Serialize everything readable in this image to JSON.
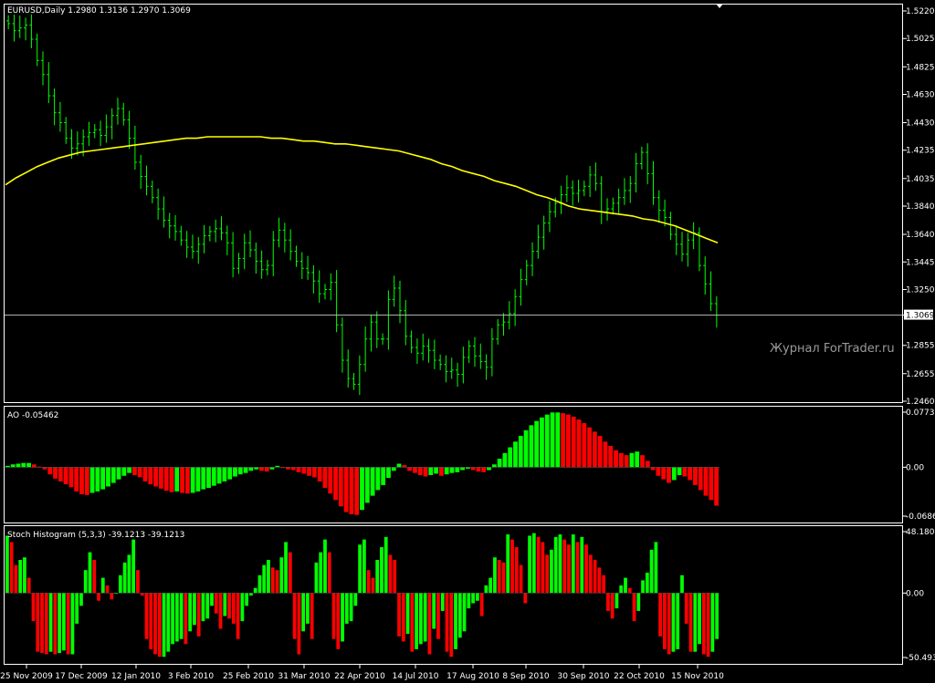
{
  "window": {
    "symbol_header": "EURUSD,Daily  1.2980 1.3136 1.2970 1.3069",
    "watermark": "Журнал ForTrader.ru"
  },
  "colors": {
    "background": "#000000",
    "frame": "#ffffff",
    "bull": "#00ff00",
    "bear": "#ff0000",
    "ma": "#ffff00",
    "watermark": "#9a9a9a"
  },
  "chart_data": [
    {
      "type": "line",
      "title": "EURUSD,Daily  1.2980 1.3136 1.2970 1.3069",
      "series": [
        {
          "name": "",
          "color": "#00ff00",
          "values": [
            1.513,
            1.508,
            1.51,
            1.512,
            1.502,
            1.487,
            1.477,
            1.462,
            1.45,
            1.443,
            1.432,
            1.425,
            1.428,
            1.433,
            1.436,
            1.438,
            1.434,
            1.44,
            1.448,
            1.453,
            1.445,
            1.432,
            1.415,
            1.405,
            1.398,
            1.39,
            1.382,
            1.374,
            1.37,
            1.366,
            1.36,
            1.355,
            1.352,
            1.357,
            1.363,
            1.366,
            1.368,
            1.365,
            1.358,
            1.34,
            1.347,
            1.358,
            1.353,
            1.345,
            1.339,
            1.342,
            1.36,
            1.367,
            1.36,
            1.352,
            1.345,
            1.34,
            1.337,
            1.331,
            1.322,
            1.325,
            1.33,
            1.3,
            1.275,
            1.262,
            1.258,
            1.272,
            1.29,
            1.302,
            1.29,
            1.29,
            1.318,
            1.326,
            1.31,
            1.292,
            1.284,
            1.28,
            1.285,
            1.282,
            1.275,
            1.272,
            1.267,
            1.268,
            1.265,
            1.277,
            1.285,
            1.278,
            1.274,
            1.27,
            1.29,
            1.3,
            1.302,
            1.308,
            1.32,
            1.332,
            1.342,
            1.352,
            1.362,
            1.372,
            1.38,
            1.386,
            1.392,
            1.397,
            1.393,
            1.395,
            1.398,
            1.406,
            1.4,
            1.38,
            1.382,
            1.386,
            1.39,
            1.395,
            1.4,
            1.414,
            1.422,
            1.407,
            1.39,
            1.381,
            1.376,
            1.364,
            1.357,
            1.35,
            1.36,
            1.365,
            1.342,
            1.329,
            1.315,
            1.3069
          ]
        },
        {
          "name": "",
          "color": "#ffff00",
          "values": [
            1.399,
            1.404,
            1.408,
            1.412,
            1.415,
            1.418,
            1.42,
            1.422,
            1.423,
            1.424,
            1.425,
            1.426,
            1.427,
            1.428,
            1.429,
            1.43,
            1.431,
            1.432,
            1.432,
            1.433,
            1.433,
            1.433,
            1.433,
            1.433,
            1.433,
            1.432,
            1.432,
            1.431,
            1.43,
            1.43,
            1.429,
            1.428,
            1.428,
            1.427,
            1.426,
            1.425,
            1.424,
            1.423,
            1.421,
            1.419,
            1.417,
            1.414,
            1.412,
            1.409,
            1.407,
            1.405,
            1.402,
            1.4,
            1.398,
            1.395,
            1.392,
            1.39,
            1.387,
            1.384,
            1.382,
            1.381,
            1.38,
            1.379,
            1.378,
            1.377,
            1.375,
            1.374,
            1.372,
            1.37,
            1.367,
            1.364,
            1.361,
            1.358
          ]
        }
      ],
      "ylim": [
        1.246,
        1.522
      ],
      "y_ticks": [
        "1.5220",
        "1.5025",
        "1.4825",
        "1.4630",
        "1.4430",
        "1.4235",
        "1.4035",
        "1.3840",
        "1.3640",
        "1.3445",
        "1.3250",
        "1.3069",
        "1.2855",
        "1.2655",
        "1.2460"
      ],
      "x_ticks": [
        "25 Nov 2009",
        "17 Dec 2009",
        "12 Jan 2010",
        "3 Feb 2010",
        "25 Feb 2010",
        "31 Mar 2010",
        "22 Apr 2010",
        "14 Jul 2010",
        "17 Aug 2010",
        "8 Sep 2010",
        "30 Sep 2010",
        "22 Oct 2010",
        "15 Nov 2010"
      ],
      "current_price": "1.3069",
      "grid": false
    },
    {
      "type": "bar",
      "title": "AO -0.05462",
      "ylim": [
        -0.06868,
        0.07738
      ],
      "y_ticks": [
        "0.07738",
        "0.00",
        "-0.06868"
      ],
      "values": [
        0.002,
        0.004,
        0.005,
        0.006,
        0.006,
        0.004,
        0.001,
        -0.003,
        -0.01,
        -0.016,
        -0.02,
        -0.024,
        -0.028,
        -0.034,
        -0.038,
        -0.039,
        -0.036,
        -0.034,
        -0.031,
        -0.027,
        -0.022,
        -0.017,
        -0.012,
        -0.008,
        -0.011,
        -0.014,
        -0.02,
        -0.024,
        -0.027,
        -0.03,
        -0.033,
        -0.035,
        -0.034,
        -0.036,
        -0.037,
        -0.036,
        -0.034,
        -0.031,
        -0.029,
        -0.026,
        -0.023,
        -0.02,
        -0.017,
        -0.013,
        -0.01,
        -0.008,
        -0.005,
        -0.003,
        -0.005,
        -0.006,
        -0.003,
        0.002,
        -0.001,
        -0.003,
        -0.004,
        -0.007,
        -0.009,
        -0.012,
        -0.014,
        -0.02,
        -0.029,
        -0.037,
        -0.046,
        -0.055,
        -0.063,
        -0.066,
        -0.067,
        -0.06,
        -0.05,
        -0.04,
        -0.032,
        -0.025,
        -0.015,
        -0.005,
        0.005,
        0.003,
        -0.005,
        -0.008,
        -0.011,
        -0.013,
        -0.011,
        -0.009,
        -0.012,
        -0.01,
        -0.008,
        -0.007,
        -0.004,
        -0.002,
        -0.004,
        -0.006,
        -0.007,
        -0.004,
        0.004,
        0.012,
        0.02,
        0.028,
        0.036,
        0.044,
        0.052,
        0.059,
        0.065,
        0.07,
        0.074,
        0.077,
        0.077,
        0.076,
        0.074,
        0.071,
        0.067,
        0.062,
        0.056,
        0.05,
        0.044,
        0.036,
        0.03,
        0.024,
        0.02,
        0.017,
        0.02,
        0.022,
        0.017,
        0.009,
        -0.004,
        -0.012,
        -0.017,
        -0.022,
        -0.018,
        -0.011,
        -0.013,
        -0.018,
        -0.025,
        -0.032,
        -0.04,
        -0.046,
        -0.054
      ]
    },
    {
      "type": "bar",
      "title": "Stoch Histogram (5,3,3) -39.1213 -39.1213",
      "ylim": [
        -50.4931,
        48.1807
      ],
      "y_ticks": [
        "48.1807",
        "0.00",
        "-50.4931"
      ],
      "values": [
        45,
        40,
        22,
        26,
        28,
        12,
        -22,
        -46,
        -47,
        -48,
        -46,
        -48,
        -47,
        -45,
        -48,
        -48,
        -24,
        -10,
        18,
        32,
        26,
        -6,
        12,
        6,
        -5,
        0,
        14,
        24,
        30,
        42,
        18,
        -2,
        -36,
        -44,
        -48,
        -50,
        -50,
        -46,
        -40,
        -38,
        -36,
        -40,
        -30,
        -25,
        -34,
        -22,
        -20,
        -10,
        -16,
        -28,
        -18,
        -20,
        -24,
        -36,
        -22,
        -10,
        -2,
        4,
        14,
        22,
        26,
        20,
        18,
        28,
        40,
        32,
        -36,
        -48,
        -30,
        -24,
        -36,
        24,
        32,
        42,
        32,
        -36,
        -44,
        -38,
        -24,
        -22,
        -10,
        38,
        42,
        18,
        12,
        26,
        36,
        44,
        30,
        26,
        -34,
        -38,
        -32,
        -46,
        -44,
        -40,
        -38,
        -48,
        -28,
        -36,
        -14,
        -46,
        -50,
        -44,
        -35,
        -30,
        -12,
        -8,
        -6,
        -18,
        6,
        12,
        28,
        26,
        24,
        46,
        42,
        36,
        22,
        -8,
        45,
        47,
        44,
        40,
        30,
        34,
        44,
        46,
        42,
        38,
        46,
        40,
        44,
        38,
        30,
        26,
        20,
        14,
        -14,
        -20,
        -12,
        6,
        12,
        4,
        -22,
        -14,
        10,
        16,
        34,
        40,
        -34,
        -44,
        -48,
        -46,
        -44,
        14,
        -24,
        -46,
        -46,
        -40,
        -48,
        -50,
        -46,
        -36
      ]
    }
  ]
}
